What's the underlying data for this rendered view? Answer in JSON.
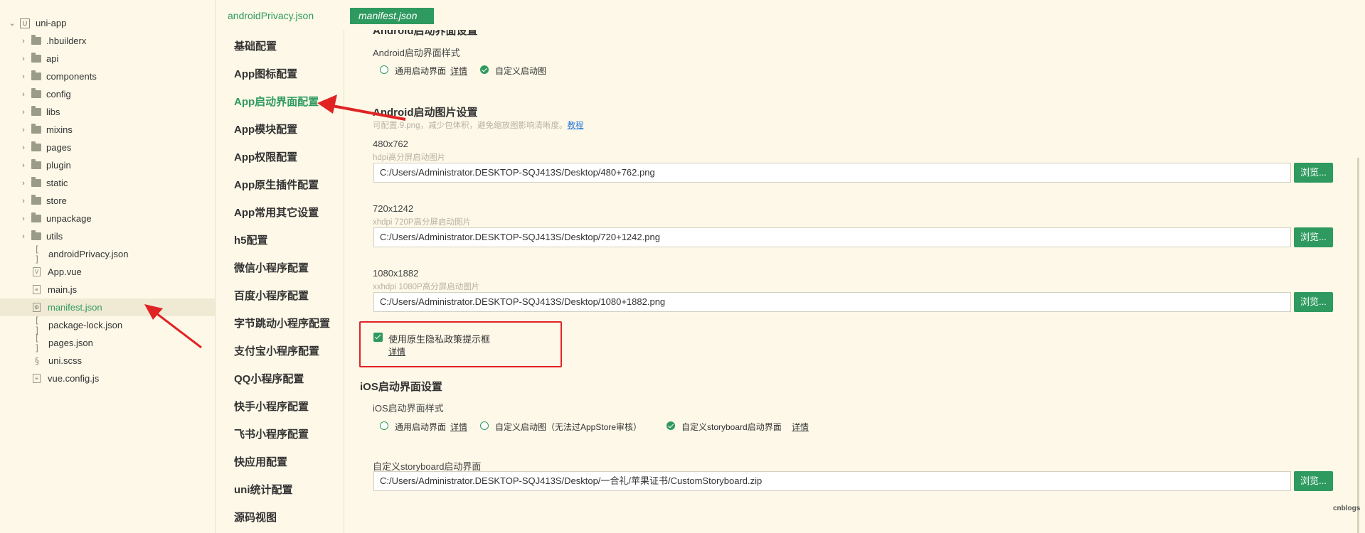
{
  "tree": {
    "root": "uni-app",
    "folders": [
      ".hbuilderx",
      "api",
      "components",
      "config",
      "libs",
      "mixins",
      "pages",
      "plugin",
      "static",
      "store",
      "unpackage",
      "utils"
    ],
    "files": [
      {
        "name": "androidPrivacy.json",
        "icon": "json-bracket-icon"
      },
      {
        "name": "App.vue",
        "icon": "vue-file-icon"
      },
      {
        "name": "main.js",
        "icon": "js-file-icon"
      },
      {
        "name": "manifest.json",
        "icon": "manifest-file-icon"
      },
      {
        "name": "package-lock.json",
        "icon": "json-bracket-icon"
      },
      {
        "name": "pages.json",
        "icon": "json-bracket-icon"
      },
      {
        "name": "uni.scss",
        "icon": "scss-file-icon"
      },
      {
        "name": "vue.config.js",
        "icon": "js-file-icon"
      }
    ]
  },
  "tabs": {
    "tab1": "androidPrivacy.json",
    "tab2": "manifest.json"
  },
  "nav": {
    "items": [
      "基础配置",
      "App图标配置",
      "App启动界面配置",
      "App模块配置",
      "App权限配置",
      "App原生插件配置",
      "App常用其它设置",
      "h5配置",
      "微信小程序配置",
      "百度小程序配置",
      "字节跳动小程序配置",
      "支付宝小程序配置",
      "QQ小程序配置",
      "快手小程序配置",
      "飞书小程序配置",
      "快应用配置",
      "uni统计配置",
      "源码视图"
    ],
    "active_index": 2
  },
  "android": {
    "cut_title": "Android启动界面设置",
    "style_label": "Android启动界面样式",
    "opt_default": "通用启动界面",
    "opt_default_link": "详情",
    "opt_custom": "自定义启动图",
    "images_title": "Android启动图片设置",
    "images_hint_text": "可配置.9.png，减少包体积，避免缩放图影响清晰度。",
    "images_hint_link": "教程",
    "images": [
      {
        "size": "480x762",
        "hint": "hdpi高分屏启动图片",
        "path": "C:/Users/Administrator.DESKTOP-SQJ413S/Desktop/480+762.png",
        "button": "浏览..."
      },
      {
        "size": "720x1242",
        "hint": "xhdpi 720P高分屏启动图片",
        "path": "C:/Users/Administrator.DESKTOP-SQJ413S/Desktop/720+1242.png",
        "button": "浏览..."
      },
      {
        "size": "1080x1882",
        "hint": "xxhdpi 1080P高分屏启动图片",
        "path": "C:/Users/Administrator.DESKTOP-SQJ413S/Desktop/1080+1882.png",
        "button": "浏览..."
      }
    ]
  },
  "privacy": {
    "label": "使用原生隐私政策提示框",
    "link": "详情",
    "checked": true
  },
  "ios": {
    "title": "iOS启动界面设置",
    "style_label": "iOS启动界面样式",
    "opt_default": "通用启动界面",
    "opt_default_link": "详情",
    "opt_custom": "自定义启动图（无法过AppStore审核）",
    "opt_storyboard": "自定义storyboard启动界面",
    "opt_storyboard_link": "详情",
    "storyboard_label": "自定义storyboard启动界面",
    "storyboard_path": "C:/Users/Administrator.DESKTOP-SQJ413S/Desktop/一合礼/苹果证书/CustomStoryboard.zip",
    "storyboard_button": "浏览..."
  },
  "watermark": "cnblogs",
  "colors": {
    "accent": "#2f9a5f",
    "annotation": "#e02424",
    "link": "#2a7ad9"
  }
}
